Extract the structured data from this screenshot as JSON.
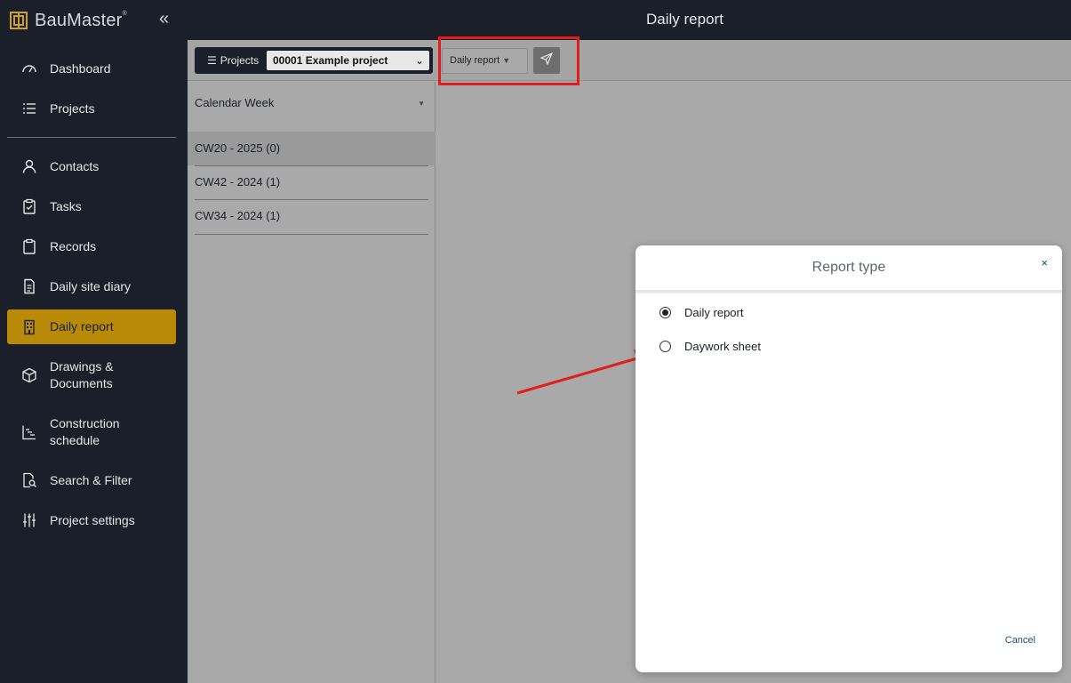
{
  "app": {
    "brand": "BauMaster",
    "brand_mark": "®"
  },
  "topbar": {
    "title": "Daily report"
  },
  "sidebar": {
    "items": [
      {
        "label": "Dashboard",
        "icon": "gauge-icon"
      },
      {
        "label": "Projects",
        "icon": "list-icon"
      },
      {
        "label": "Contacts",
        "icon": "person-icon"
      },
      {
        "label": "Tasks",
        "icon": "clipboard-check-icon"
      },
      {
        "label": "Records",
        "icon": "clipboard-icon"
      },
      {
        "label": "Daily site diary",
        "icon": "document-icon"
      },
      {
        "label": "Daily report",
        "icon": "building-icon",
        "active": true
      },
      {
        "label": "Drawings & Documents",
        "line1": "Drawings &",
        "line2": "Documents",
        "icon": "cube-icon"
      },
      {
        "label": "Construction schedule",
        "line1": "Construction",
        "line2": "schedule",
        "icon": "chart-icon"
      },
      {
        "label": "Search & Filter",
        "icon": "search-doc-icon"
      },
      {
        "label": "Project settings",
        "icon": "sliders-icon"
      }
    ]
  },
  "toolbar": {
    "projects_label": "Projects",
    "project_value": "00001 Example project",
    "report_dropdown": "Daily report"
  },
  "left_panel": {
    "header": "Calendar Week",
    "weeks": [
      "CW20 - 2025 (0)",
      "CW42 - 2024 (1)",
      "CW34 - 2024 (1)"
    ]
  },
  "modal": {
    "title": "Report type",
    "close": "×",
    "options": [
      {
        "label": "Daily report",
        "selected": true
      },
      {
        "label": "Daywork sheet",
        "selected": false
      }
    ],
    "cancel": "Cancel"
  },
  "colors": {
    "accent": "#b88a08",
    "sidebar_bg": "#1b1f29",
    "highlight": "#e11d1d",
    "link": "#1f4a7a"
  }
}
